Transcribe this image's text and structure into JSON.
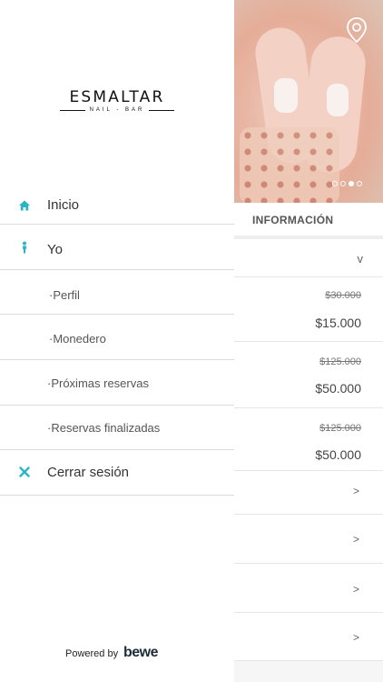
{
  "drawer": {
    "logo": {
      "brand": "ESMALTAR",
      "tagline": "NAIL - BAR"
    },
    "menu": [
      {
        "label": "Inicio",
        "icon": "home-icon"
      },
      {
        "label": "Yo",
        "icon": "person-icon"
      }
    ],
    "submenu": [
      "·Perfil",
      "·Monedero",
      "·Próximas reservas",
      "·Reservas finalizadas"
    ],
    "logout": {
      "label": "Cerrar sesión",
      "icon": "close-icon"
    },
    "footer": {
      "powered_by": "Powered by",
      "brand": "bewe"
    }
  },
  "background": {
    "section_title": "INFORMACIÓN",
    "services": [
      {
        "old_price": "$30.000",
        "price": "$15.000"
      },
      {
        "old_price": "$125.000",
        "price": "$50.000"
      },
      {
        "old_price": "$125.000",
        "price": "$50.000"
      }
    ],
    "expand_glyph": "v",
    "row_chevron": ">",
    "carousel": {
      "total": 4,
      "active": 3
    }
  },
  "colors": {
    "accent": "#2bb5c4",
    "divider": "#dcdcdc"
  }
}
